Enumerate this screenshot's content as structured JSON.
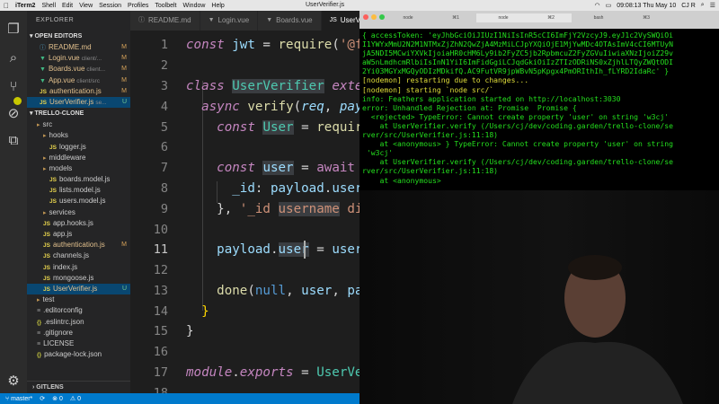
{
  "menubar": {
    "apple": "",
    "items": [
      "iTerm2",
      "Shell",
      "Edit",
      "View",
      "Session",
      "Profiles",
      "Toolbelt",
      "Window",
      "Help"
    ],
    "window_title": "UserVerifier.js",
    "clock": "09:08:13 Thu May 10",
    "user": "CJ R"
  },
  "sidebar": {
    "title": "EXPLORER",
    "open_editors_header": "OPEN EDITORS",
    "open_editors": [
      {
        "name": "README.md",
        "kind": "md",
        "hint": "",
        "flag": "M"
      },
      {
        "name": "Login.vue",
        "kind": "vue",
        "hint": "client/...",
        "flag": "M"
      },
      {
        "name": "Boards.vue",
        "kind": "vue",
        "hint": "client...",
        "flag": "M"
      },
      {
        "name": "App.vue",
        "kind": "vue",
        "hint": "client/src",
        "flag": "M"
      },
      {
        "name": "authentication.js",
        "kind": "js",
        "hint": "",
        "flag": "M"
      },
      {
        "name": "UserVerifier.js",
        "kind": "js",
        "hint": "se...",
        "flag": "U"
      }
    ],
    "project_header": "TRELLO-CLONE",
    "tree": [
      {
        "name": "src",
        "kind": "folder",
        "indent": 1,
        "flag": ""
      },
      {
        "name": "hooks",
        "kind": "folder",
        "indent": 2,
        "flag": ""
      },
      {
        "name": "logger.js",
        "kind": "js",
        "indent": 3,
        "flag": ""
      },
      {
        "name": "middleware",
        "kind": "folder",
        "indent": 2,
        "flag": ""
      },
      {
        "name": "models",
        "kind": "folder",
        "indent": 2,
        "flag": ""
      },
      {
        "name": "boards.model.js",
        "kind": "js",
        "indent": 3,
        "flag": ""
      },
      {
        "name": "lists.model.js",
        "kind": "js",
        "indent": 3,
        "flag": ""
      },
      {
        "name": "users.model.js",
        "kind": "js",
        "indent": 3,
        "flag": ""
      },
      {
        "name": "services",
        "kind": "folder",
        "indent": 2,
        "flag": ""
      },
      {
        "name": "app.hooks.js",
        "kind": "js",
        "indent": 2,
        "flag": ""
      },
      {
        "name": "app.js",
        "kind": "js",
        "indent": 2,
        "flag": ""
      },
      {
        "name": "authentication.js",
        "kind": "js",
        "indent": 2,
        "flag": "M"
      },
      {
        "name": "channels.js",
        "kind": "js",
        "indent": 2,
        "flag": ""
      },
      {
        "name": "index.js",
        "kind": "js",
        "indent": 2,
        "flag": ""
      },
      {
        "name": "mongoose.js",
        "kind": "js",
        "indent": 2,
        "flag": ""
      },
      {
        "name": "UserVerifier.js",
        "kind": "js",
        "indent": 2,
        "flag": "U"
      },
      {
        "name": "test",
        "kind": "folder",
        "indent": 1,
        "flag": ""
      },
      {
        "name": ".editorconfig",
        "kind": "cfg",
        "indent": 1,
        "flag": ""
      },
      {
        "name": ".eslintrc.json",
        "kind": "json",
        "indent": 1,
        "flag": ""
      },
      {
        "name": ".gitignore",
        "kind": "cfg",
        "indent": 1,
        "flag": ""
      },
      {
        "name": "LICENSE",
        "kind": "cfg",
        "indent": 1,
        "flag": ""
      },
      {
        "name": "package-lock.json",
        "kind": "json",
        "indent": 1,
        "flag": ""
      }
    ],
    "gitlens_label": "GITLENS"
  },
  "tabs": [
    {
      "label": "README.md",
      "kind": "md",
      "active": false
    },
    {
      "label": "Login.vue",
      "kind": "vue",
      "active": false
    },
    {
      "label": "Boards.vue",
      "kind": "vue",
      "active": false
    },
    {
      "label": "UserVerifier.js",
      "kind": "js",
      "active": true
    }
  ],
  "editor": {
    "line_numbers": [
      "1",
      "2",
      "3",
      "4",
      "5",
      "6",
      "7",
      "8",
      "9",
      "10",
      "11",
      "12",
      "13",
      "14",
      "15",
      "16",
      "17",
      "18"
    ]
  },
  "status": {
    "branch": "master*",
    "sync": "⟳",
    "errors": "⊗ 0",
    "warnings": "⚠ 0"
  },
  "terminal": {
    "tabs": [
      "node",
      "⌘1",
      "node",
      "⌘2",
      "bash",
      "⌘3"
    ],
    "lines": [
      [
        {
          "c": "g",
          "t": "{ accessToken: 'eyJhbGciOiJIUzI1NiIsInR5cCI6ImFjY2VzcyJ9.eyJ1c2VySWQiOi"
        }
      ],
      [
        {
          "c": "g",
          "t": "I1YWYxMmU2N2M1NTMxZjZhN2QwZjA4MzMiLCJpYXQiOjE1MjYwMDc4OTAsImV4cCI6MTUyN"
        }
      ],
      [
        {
          "c": "g",
          "t": "jA5NDI5MCwiYXVkIjoiaHR0cHM6Ly9ib2FyZC5jb2RpbmcuZ2FyZGVuIiwiaXNzIjoiZ29v"
        }
      ],
      [
        {
          "c": "g",
          "t": "aW5nLmdhcmRlbiIsInN1YiI6ImFidGgiLCJqdGkiOiIzZTIzODRiNS0xZjhlLTQyZWQtODI"
        }
      ],
      [
        {
          "c": "g",
          "t": "2Yi03MGYxMGQyODIzMDkifQ.AC9FutVR9jpWBvN5pKpgx4PmORIthIh_fLYRD2IdaRc' }"
        }
      ],
      [
        {
          "c": "y",
          "t": "[nodemon] restarting due to changes..."
        }
      ],
      [
        {
          "c": "y",
          "t": "[nodemon] starting `node src/`"
        }
      ],
      [
        {
          "c": "g",
          "t": "info: Feathers application started on http://localhost:3030"
        }
      ],
      [
        {
          "c": "g",
          "t": "error: Unhandled Rejection at: Promise  Promise {"
        }
      ],
      [
        {
          "c": "g",
          "t": "  <rejected> TypeError: Cannot create property 'user' on string 'w3cj'"
        }
      ],
      [
        {
          "c": "g",
          "t": "    at UserVerifier.verify (/Users/cj/dev/coding.garden/trello-clone/se"
        }
      ],
      [
        {
          "c": "g",
          "t": "rver/src/UserVerifier.js:11:18)"
        }
      ],
      [
        {
          "c": "g",
          "t": "    at <anonymous> } TypeError: Cannot create property 'user' on string"
        }
      ],
      [
        {
          "c": "g",
          "t": " 'w3cj'"
        }
      ],
      [
        {
          "c": "g",
          "t": "    at UserVerifier.verify (/Users/cj/dev/coding.garden/trello-clone/se"
        }
      ],
      [
        {
          "c": "g",
          "t": "rver/src/UserVerifier.js:11:18)"
        }
      ],
      [
        {
          "c": "g",
          "t": "    at <anonymous>"
        }
      ]
    ]
  },
  "colors": {
    "accent": "#007acc",
    "terminal_green": "#24e01e",
    "nodemon_yellow": "#e0de3a"
  }
}
